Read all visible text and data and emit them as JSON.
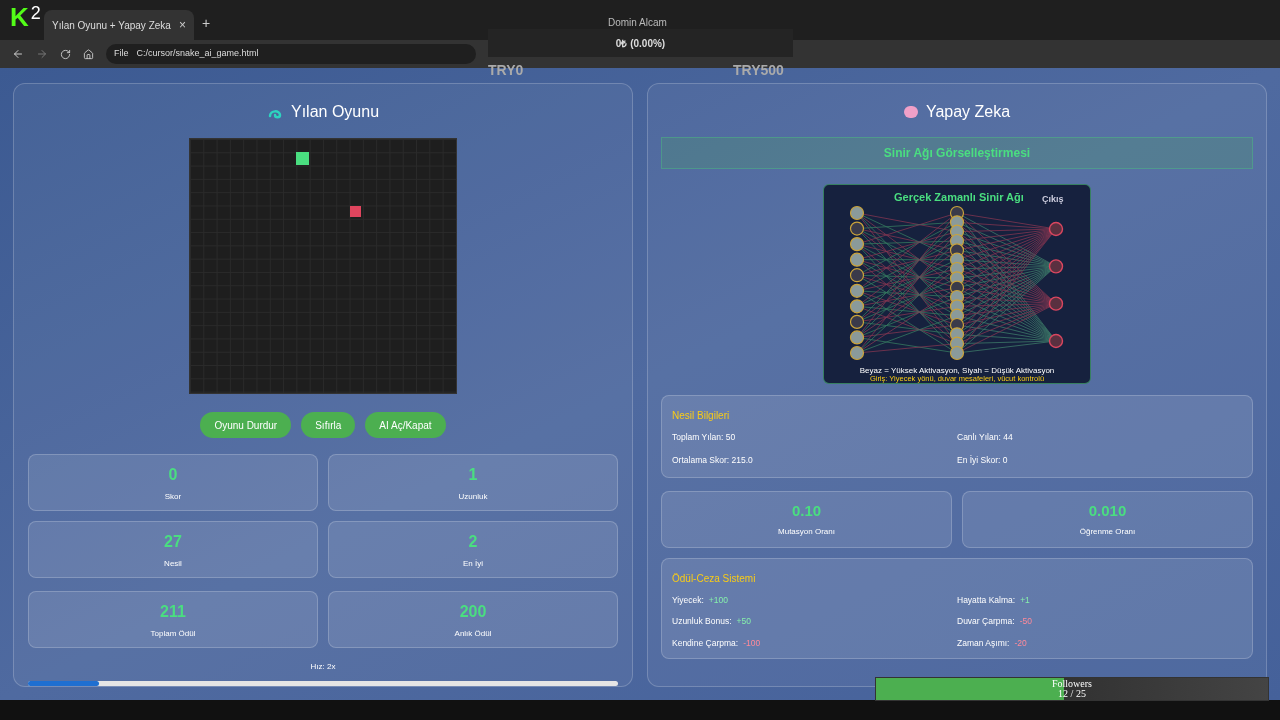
{
  "overlay": {
    "logo": "K",
    "logo_number": "2",
    "streamer": "Domin Alcam",
    "balance": "0₺ (0.00%)",
    "goal_min": "TRY0",
    "goal_max": "TRY500",
    "followers": {
      "label": "Followers",
      "count": "12 / 25",
      "level": 0.48
    }
  },
  "browser": {
    "tab": {
      "title": "Yılan Oyunu + Yapay Zeka",
      "close": "×",
      "selected": true
    },
    "new_tab": "+",
    "scheme": "File",
    "url": "C:/cursor/snake_ai_game.html"
  },
  "game": {
    "title": "Yılan Oyunu",
    "buttons": [
      "Oyunu Durdur",
      "Sıfırla",
      "AI Aç/Kapat"
    ],
    "stats": [
      {
        "value": "0",
        "label": "Skor"
      },
      {
        "value": "1",
        "label": "Uzunluk"
      },
      {
        "value": "27",
        "label": "Nesil"
      },
      {
        "value": "2",
        "label": "En İyi"
      },
      {
        "value": "211",
        "label": "Toplam Ödül"
      },
      {
        "value": "200",
        "label": "Anlık Ödül"
      }
    ],
    "speed": {
      "label": "Hız: 2x",
      "level": 0.12
    }
  },
  "ai": {
    "title": "Yapay Zeka",
    "section": "Sinir Ağı Görselleştirmesi",
    "network": {
      "title": "Gerçek Zamanlı Sinir Ağı",
      "output_heading": "Çıkış",
      "legend": "Beyaz = Yüksek Aktivasyon, Siyah = Düşük Aktivasyon",
      "note": "Giriş: Yiyecek yönü, duvar mesafeleri, vücut kontrolü"
    },
    "generation": {
      "title": "Nesil Bilgileri",
      "items": [
        "Toplam Yılan: 50",
        "Canlı Yılan: 44",
        "Ortalama Skor: 215.0",
        "En İyi Skor: 0"
      ]
    },
    "rates": [
      {
        "value": "0.10",
        "label": "Mutasyon Oranı"
      },
      {
        "value": "0.010",
        "label": "Öğrenme Oranı"
      }
    ],
    "rewards": {
      "title": "Ödül-Ceza Sistemi",
      "items": [
        {
          "label": "Yiyecek:",
          "value": "+100",
          "kind": "reward"
        },
        {
          "label": "Hayatta Kalma:",
          "value": "+1",
          "kind": "reward"
        },
        {
          "label": "Uzunluk Bonus:",
          "value": "+50",
          "kind": "reward"
        },
        {
          "label": "Duvar Çarpma:",
          "value": "-50",
          "kind": "penalty"
        },
        {
          "label": "Kendine Çarpma:",
          "value": "-100",
          "kind": "penalty"
        },
        {
          "label": "Zaman Aşımı:",
          "value": "-20",
          "kind": "penalty"
        }
      ]
    }
  }
}
